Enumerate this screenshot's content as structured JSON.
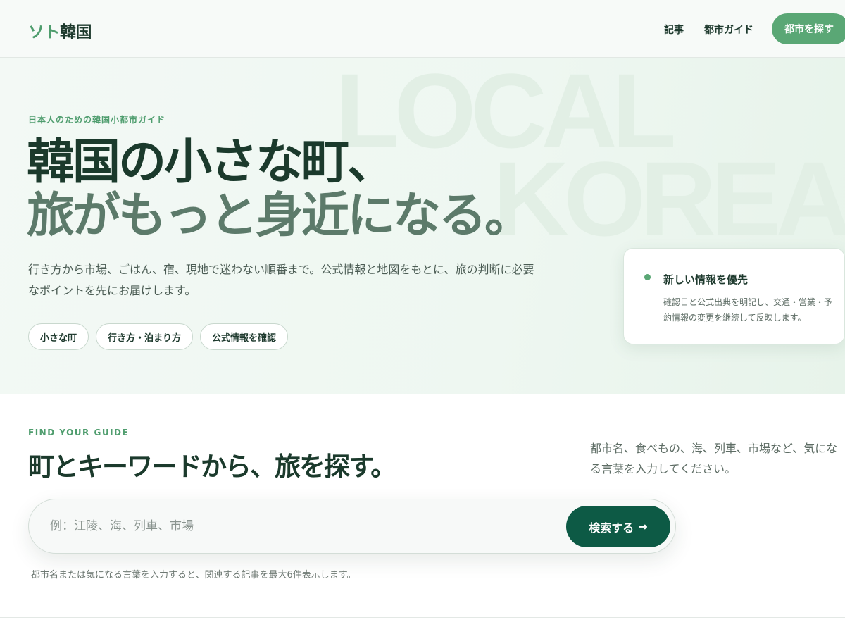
{
  "header": {
    "logo_accent": "ソト",
    "logo_main": "韓国",
    "nav": [
      {
        "label": "記事"
      },
      {
        "label": "都市ガイド"
      }
    ],
    "cta_label": "都市を探す"
  },
  "hero": {
    "bg_word_1": "LOCAL",
    "bg_word_2": "KOREA",
    "eyebrow": "日本人のための韓国小都市ガイド",
    "title_line1": "韓国の小さな町、",
    "title_line2": "旅がもっと身近になる。",
    "description": "行き方から市場、ごはん、宿、現地で迷わない順番まで。公式情報と地図をもとに、旅の判断に必要なポイントを先にお届けします。",
    "chips": [
      {
        "label": "小さな町"
      },
      {
        "label": "行き方・泊まり方"
      },
      {
        "label": "公式情報を確認"
      }
    ],
    "info_card": {
      "title": "新しい情報を優先",
      "body": "確認日と公式出典を明記し、交通・営業・予約情報の変更を継続して反映します。"
    }
  },
  "search": {
    "eyebrow": "FIND YOUR GUIDE",
    "title": "町とキーワードから、旅を探す。",
    "description": "都市名、食べもの、海、列車、市場など、気になる言葉を入力してください。",
    "placeholder": "例：江陵、海、列車、市場",
    "value": "",
    "button_label": "検索する",
    "button_arrow": "→",
    "note": "都市名または気になる言葉を入力すると、関連する記事を最大6件表示します。"
  },
  "colors": {
    "accent": "#5aa775",
    "dark_green": "#0d5a45",
    "text": "#1e3a2e"
  }
}
